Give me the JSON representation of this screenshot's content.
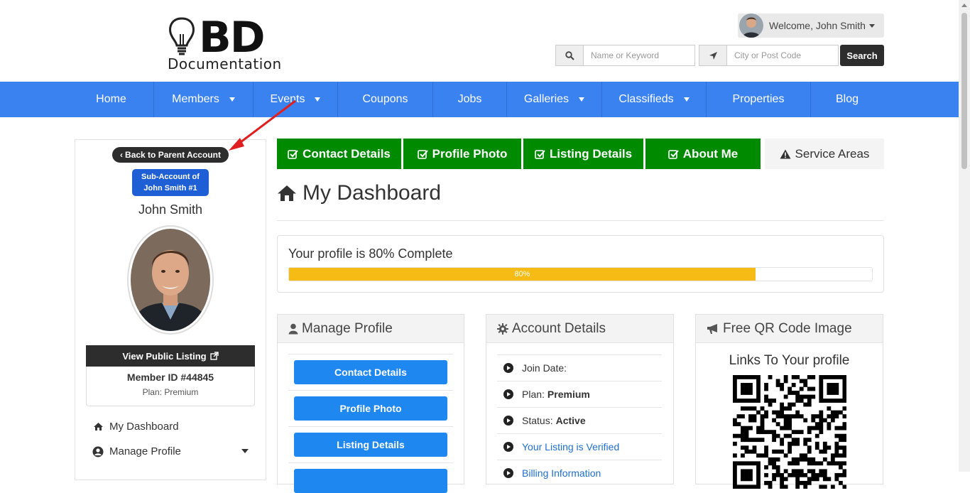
{
  "header": {
    "logo_letters": "BD",
    "logo_text": "Documentation",
    "welcome_text": "Welcome, John Smith",
    "search_placeholder": "Name or Keyword",
    "location_placeholder": "City or Post Code",
    "search_button": "Search"
  },
  "nav": {
    "items": [
      {
        "label": "Home",
        "dropdown": false
      },
      {
        "label": "Members",
        "dropdown": true
      },
      {
        "label": "Events",
        "dropdown": true
      },
      {
        "label": "Coupons",
        "dropdown": false
      },
      {
        "label": "Jobs",
        "dropdown": false
      },
      {
        "label": "Galleries",
        "dropdown": true
      },
      {
        "label": "Classifieds",
        "dropdown": true
      },
      {
        "label": "Properties",
        "dropdown": false
      },
      {
        "label": "Blog",
        "dropdown": false
      }
    ]
  },
  "sidebar": {
    "back_button": "Back to Parent Account",
    "sub_account_line1": "Sub-Account of",
    "sub_account_line2": "John Smith #1",
    "name": "John Smith",
    "view_listing": "View Public Listing",
    "member_id": "Member ID #44845",
    "plan": "Plan: Premium",
    "menu": [
      {
        "label": "My Dashboard",
        "icon": "home-icon"
      },
      {
        "label": "Manage Profile",
        "icon": "user-circle-icon"
      }
    ]
  },
  "tabs": [
    {
      "label": "Contact Details",
      "status": "complete"
    },
    {
      "label": "Profile Photo",
      "status": "complete"
    },
    {
      "label": "Listing Details",
      "status": "complete"
    },
    {
      "label": "About Me",
      "status": "complete"
    },
    {
      "label": "Service Areas",
      "status": "warning"
    }
  ],
  "dashboard": {
    "title": "My Dashboard",
    "progress_label": "Your profile is 80% Complete",
    "progress_value": 0.8,
    "progress_text": "80%"
  },
  "manage_profile": {
    "title": "Manage Profile",
    "buttons": [
      "Contact Details",
      "Profile Photo",
      "Listing Details"
    ]
  },
  "account_details": {
    "title": "Account Details",
    "rows": [
      {
        "label": "Join Date:",
        "value": ""
      },
      {
        "label": "Plan:",
        "value": "Premium"
      },
      {
        "label": "Status:",
        "value": "Active"
      },
      {
        "link": "Your Listing is Verified"
      },
      {
        "link": "Billing Information"
      }
    ]
  },
  "qr": {
    "title": "Free QR Code Image",
    "subtitle": "Links To Your profile"
  },
  "colors": {
    "nav": "#3a82f0",
    "tab_green": "#008a00",
    "progress": "#f6bb14",
    "button_blue": "#1f87f0",
    "badge_blue": "#1f5fd6",
    "arrow_red": "#e02020"
  }
}
